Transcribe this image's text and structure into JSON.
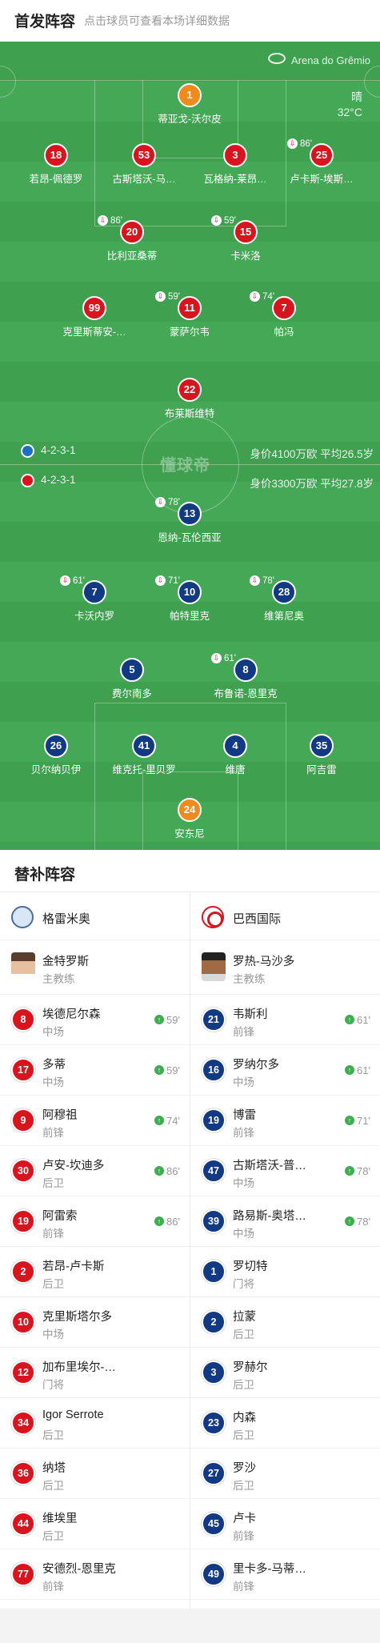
{
  "header": {
    "title": "首发阵容",
    "subtitle": "点击球员可查看本场详细数据"
  },
  "pitch": {
    "venue": "Arena do Grêmio",
    "weather": "晴",
    "temperature": "32°C",
    "watermark": "懂球帝",
    "home": {
      "formation": "4-2-3-1",
      "value": "身价4100万欧",
      "avg_age": "平均26.5岁"
    },
    "away": {
      "formation": "4-2-3-1",
      "value": "身价3300万欧",
      "avg_age": "平均27.8岁"
    }
  },
  "home_lineup": [
    {
      "num": "1",
      "name": "蒂亚戈-沃尔皮",
      "color": "orange"
    },
    {
      "num": "18",
      "name": "若昂-佩德罗",
      "color": "red"
    },
    {
      "num": "53",
      "name": "古斯塔沃-马…",
      "color": "red",
      "yellow": true
    },
    {
      "num": "3",
      "name": "瓦格纳-莱昂…",
      "color": "red"
    },
    {
      "num": "25",
      "name": "卢卡斯-埃斯…",
      "color": "red",
      "sub": "86'"
    },
    {
      "num": "20",
      "name": "比利亚桑蒂",
      "color": "red",
      "sub": "86'",
      "captain": "C"
    },
    {
      "num": "15",
      "name": "卡米洛",
      "color": "red",
      "sub": "59'"
    },
    {
      "num": "99",
      "name": "克里斯蒂安-…",
      "color": "red"
    },
    {
      "num": "11",
      "name": "蒙萨尔韦",
      "color": "red",
      "sub": "59'"
    },
    {
      "num": "7",
      "name": "帕冯",
      "color": "red",
      "sub": "74'"
    },
    {
      "num": "22",
      "name": "布莱斯维特",
      "color": "red"
    }
  ],
  "away_lineup": [
    {
      "num": "13",
      "name": "恩纳-瓦伦西亚",
      "color": "blue",
      "sub": "78'"
    },
    {
      "num": "7",
      "name": "卡沃内罗",
      "color": "blue",
      "sub": "61'",
      "goal": true
    },
    {
      "num": "10",
      "name": "帕特里克",
      "color": "blue",
      "sub": "71'",
      "goal": true,
      "captain": "C"
    },
    {
      "num": "28",
      "name": "维第尼奥",
      "color": "blue",
      "sub": "78'"
    },
    {
      "num": "5",
      "name": "费尔南多",
      "color": "blue"
    },
    {
      "num": "8",
      "name": "布鲁诺-恩里克",
      "color": "blue",
      "sub": "61'"
    },
    {
      "num": "26",
      "name": "贝尔纳贝伊",
      "color": "blue",
      "yellow": true
    },
    {
      "num": "41",
      "name": "维克托-里贝罗",
      "color": "blue"
    },
    {
      "num": "4",
      "name": "维唐",
      "color": "blue"
    },
    {
      "num": "35",
      "name": "阿吉雷",
      "color": "blue"
    },
    {
      "num": "24",
      "name": "安东尼",
      "color": "orange",
      "yellow": true
    }
  ],
  "subs": {
    "title": "替补阵容",
    "home": {
      "team": "格雷米奥",
      "coach": {
        "name": "金特罗斯",
        "role": "主教练"
      },
      "players": [
        {
          "num": "8",
          "name": "埃德尼尔森",
          "pos": "中场",
          "min": "59'"
        },
        {
          "num": "17",
          "name": "多蒂",
          "pos": "中场",
          "min": "59'"
        },
        {
          "num": "9",
          "name": "阿穆祖",
          "pos": "前锋",
          "min": "74'"
        },
        {
          "num": "30",
          "name": "卢安-坎迪多",
          "pos": "后卫",
          "min": "86'"
        },
        {
          "num": "19",
          "name": "阿雷索",
          "pos": "前锋",
          "min": "86'"
        },
        {
          "num": "2",
          "name": "若昂-卢卡斯",
          "pos": "后卫",
          "min": ""
        },
        {
          "num": "10",
          "name": "克里斯塔尔多",
          "pos": "中场",
          "min": ""
        },
        {
          "num": "12",
          "name": "加布里埃尔-…",
          "pos": "门将",
          "min": ""
        },
        {
          "num": "34",
          "name": "Igor Serrote",
          "pos": "后卫",
          "min": ""
        },
        {
          "num": "36",
          "name": "纳塔",
          "pos": "后卫",
          "min": ""
        },
        {
          "num": "44",
          "name": "维埃里",
          "pos": "后卫",
          "min": ""
        },
        {
          "num": "77",
          "name": "安德烈-恩里克",
          "pos": "前锋",
          "min": ""
        }
      ]
    },
    "away": {
      "team": "巴西国际",
      "coach": {
        "name": "罗热-马沙多",
        "role": "主教练"
      },
      "players": [
        {
          "num": "21",
          "name": "韦斯利",
          "pos": "前锋",
          "min": "61'"
        },
        {
          "num": "16",
          "name": "罗纳尔多",
          "pos": "中场",
          "min": "61'"
        },
        {
          "num": "19",
          "name": "博雷",
          "pos": "前锋",
          "min": "71'"
        },
        {
          "num": "47",
          "name": "古斯塔沃-普…",
          "pos": "中场",
          "min": "78'"
        },
        {
          "num": "39",
          "name": "路易斯-奥塔…",
          "pos": "中场",
          "min": "78'"
        },
        {
          "num": "1",
          "name": "罗切特",
          "pos": "门将",
          "min": ""
        },
        {
          "num": "2",
          "name": "拉蒙",
          "pos": "后卫",
          "min": ""
        },
        {
          "num": "3",
          "name": "罗赫尔",
          "pos": "后卫",
          "min": ""
        },
        {
          "num": "23",
          "name": "内森",
          "pos": "后卫",
          "min": ""
        },
        {
          "num": "27",
          "name": "罗沙",
          "pos": "后卫",
          "min": ""
        },
        {
          "num": "45",
          "name": "卢卡",
          "pos": "前锋",
          "min": ""
        },
        {
          "num": "49",
          "name": "里卡多-马蒂…",
          "pos": "前锋",
          "min": ""
        }
      ]
    }
  }
}
